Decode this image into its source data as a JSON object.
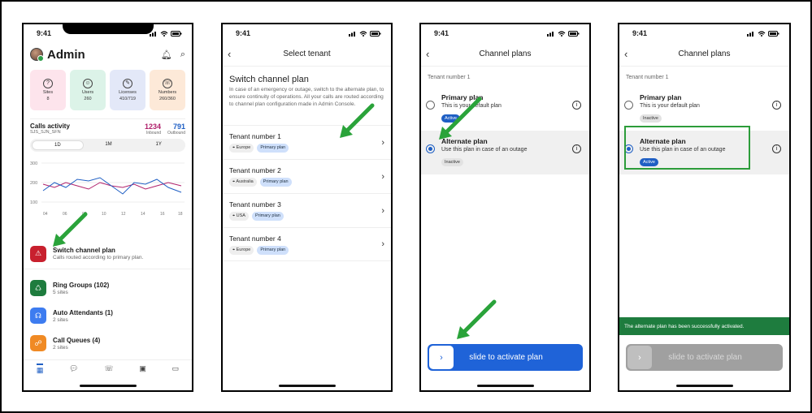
{
  "time": "9:41",
  "colors": {
    "accent": "#1f5fc4",
    "slider": "#1f63d8",
    "arrow": "#2aa33a",
    "toast": "#1e7c3e",
    "alert": "#c8202e"
  },
  "p1": {
    "title": "Admin",
    "tiles": [
      {
        "label": "Sites",
        "value": "8",
        "icon": "?",
        "bg": "#fde4ec"
      },
      {
        "label": "Users",
        "value": "260",
        "icon": "☺",
        "bg": "#dcf3e8"
      },
      {
        "label": "Licenses",
        "value": "410/719",
        "icon": "✎",
        "bg": "#e3e8f8"
      },
      {
        "label": "Numbers",
        "value": "260/360",
        "icon": "☏",
        "bg": "#fde9d8"
      }
    ],
    "calls": {
      "title": "Calls activity",
      "subtitle": "SJS_SJN_SFN",
      "inbound_value": "1234",
      "inbound_label": "Inbound",
      "outbound_value": "791",
      "outbound_label": "Outbound",
      "ranges": [
        "1D",
        "1M",
        "1Y"
      ],
      "y_ticks": [
        "300",
        "200",
        "100"
      ],
      "x_ticks": [
        "04",
        "06",
        "08",
        "10",
        "12",
        "14",
        "16",
        "18"
      ]
    },
    "rows": [
      {
        "title": "Switch channel plan",
        "sub": "Calls routed according to primary plan.",
        "icon": "⚠",
        "bg": "#c8202e"
      },
      {
        "title": "Ring Groups (102)",
        "sub": "5 sites",
        "icon": "♺",
        "bg": "#1e7c3e"
      },
      {
        "title": "Auto Attendants (1)",
        "sub": "2 sites",
        "icon": "☊",
        "bg": "#3d7cf0"
      },
      {
        "title": "Call Queues (4)",
        "sub": "2 sites",
        "icon": "☍",
        "bg": "#f08a24"
      }
    ]
  },
  "p2": {
    "nav_title": "Select tenant",
    "heading": "Switch channel plan",
    "description": "In case of an emergency or outage, switch to the alternate plan, to ensure continuity of operations. All your calls are routed according to channel plan configuration made in Admin Console.",
    "tenants": [
      {
        "name": "Tenant number 1",
        "region": "Europe",
        "plan": "Primary plan"
      },
      {
        "name": "Tenant number 2",
        "region": "Australia",
        "plan": "Primary plan"
      },
      {
        "name": "Tenant number 3",
        "region": "USA",
        "plan": "Primary plan"
      },
      {
        "name": "Tenant number 4",
        "region": "Europe",
        "plan": "Primary plan"
      }
    ]
  },
  "p3": {
    "nav_title": "Channel plans",
    "tenant": "Tenant number 1",
    "primary": {
      "title": "Primary plan",
      "desc": "This is your default plan",
      "badge": "Active"
    },
    "alternate": {
      "title": "Alternate plan",
      "desc": "Use this plan in case of an outage",
      "badge": "Inactive"
    },
    "slider": "slide to activate plan"
  },
  "p4": {
    "nav_title": "Channel plans",
    "tenant": "Tenant number 1",
    "primary": {
      "title": "Primary plan",
      "desc": "This is your default plan",
      "badge": "Inactive"
    },
    "alternate": {
      "title": "Alternate plan",
      "desc": "Use this plan in case of an outage",
      "badge": "Active"
    },
    "toast": "The alternate plan has been successfully activated.",
    "slider": "slide to activate plan"
  }
}
